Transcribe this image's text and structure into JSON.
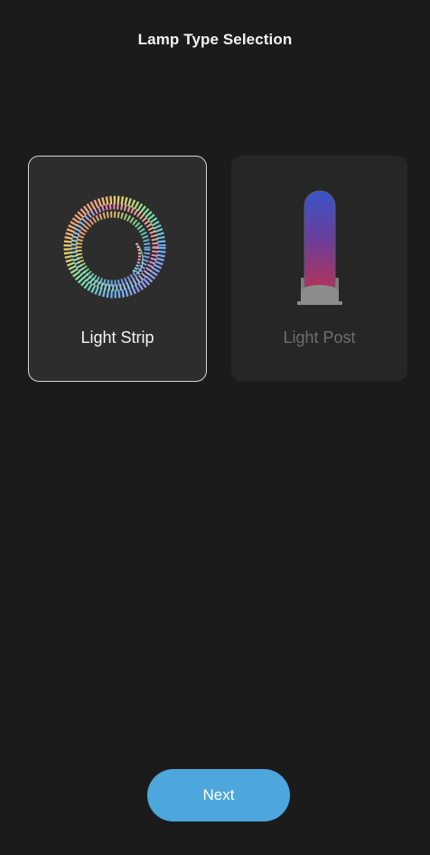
{
  "header": {
    "title": "Lamp Type Selection"
  },
  "options": [
    {
      "label": "Light Strip",
      "icon": "light-strip-icon",
      "selected": true
    },
    {
      "label": "Light Post",
      "icon": "light-post-icon",
      "selected": false
    }
  ],
  "footer": {
    "next_label": "Next"
  },
  "colors": {
    "background": "#1b1b1b",
    "card_selected": "#2d2d2d",
    "card_unselected": "#262626",
    "accent": "#4da6dc",
    "label_disabled": "#6e6e6e"
  }
}
